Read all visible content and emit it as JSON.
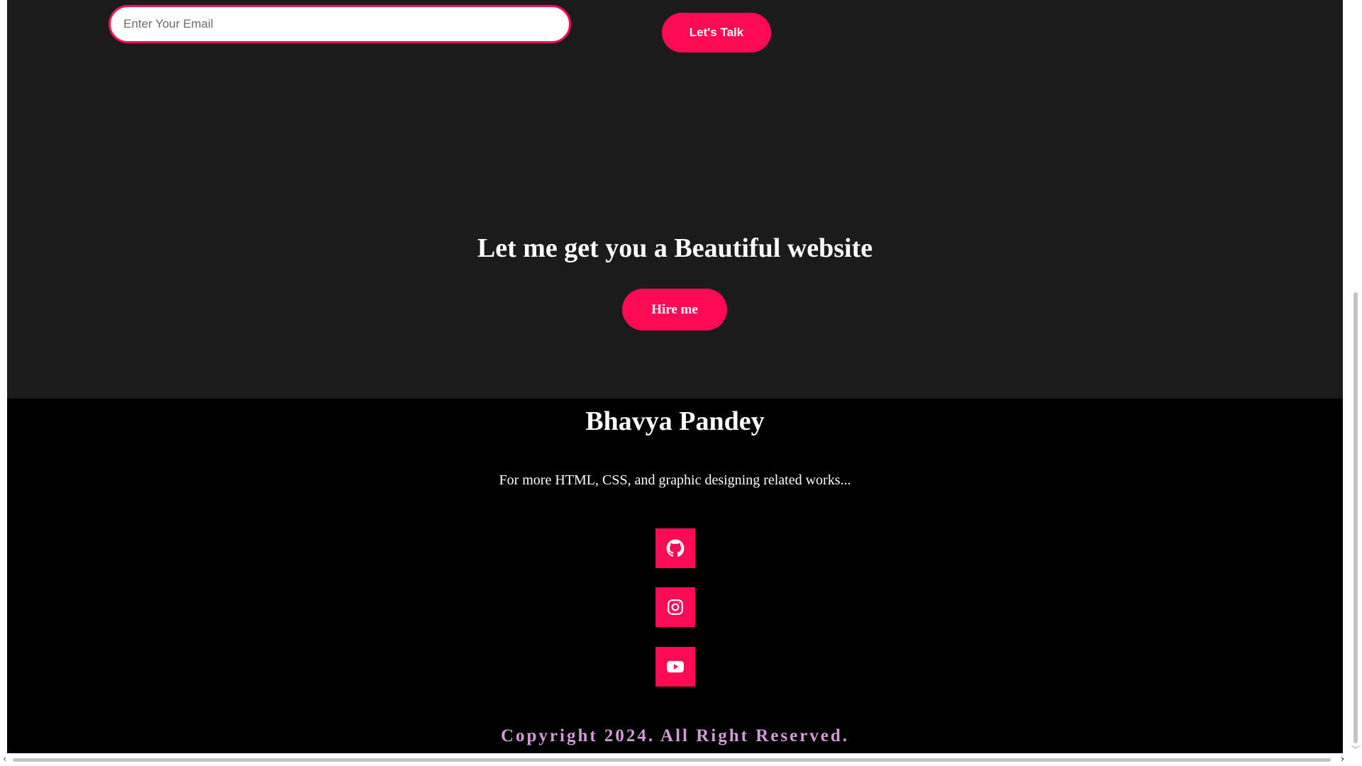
{
  "contact": {
    "email_placeholder": "Enter Your Email",
    "email_value": "",
    "talk_button": "Let's Talk"
  },
  "cta": {
    "heading": "Let me get you a Beautiful website",
    "hire_button": "Hire me"
  },
  "footer": {
    "name": "Bhavya Pandey",
    "tagline": "For more HTML, CSS, and graphic designing related works...",
    "social_links": [
      {
        "icon": "github-icon"
      },
      {
        "icon": "instagram-icon"
      },
      {
        "icon": "youtube-icon"
      }
    ],
    "copyright": "Copyright 2024. All Right Reserved."
  },
  "colors": {
    "accent": "#ff0a55",
    "dark_bg": "#1b1b1c",
    "footer_bg": "#000000",
    "copyright_text": "#d49ad8"
  }
}
